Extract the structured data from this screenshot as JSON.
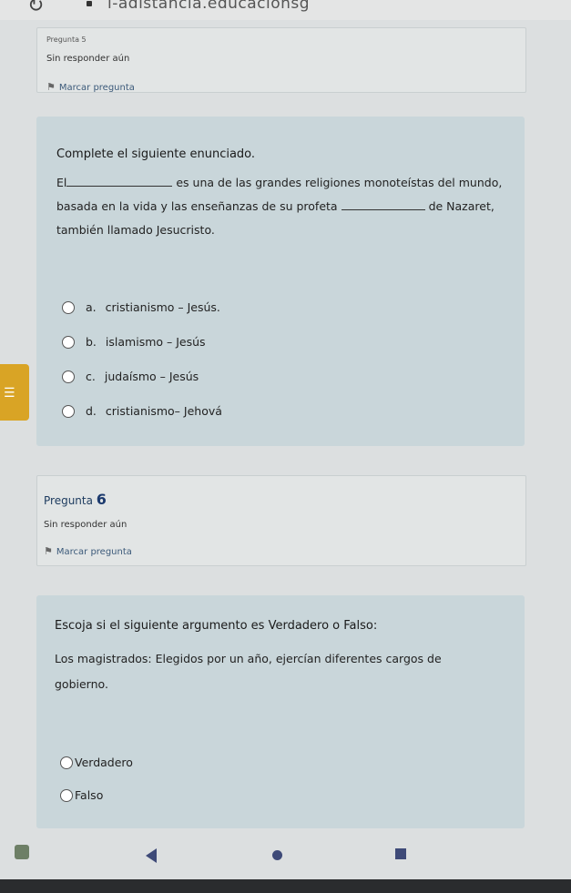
{
  "browser": {
    "url": "i-adistancia.educacionsg"
  },
  "question5_info": {
    "title": "Pregunta 5",
    "status": "Sin responder aún",
    "flag_label": "Marcar pregunta"
  },
  "question5": {
    "prompt": "Complete el siguiente enunciado.",
    "text_start": "El",
    "text_part1": "es una de las grandes religiones monoteístas del mundo,",
    "text_part2": "basada en la vida y las enseñanzas de su profeta",
    "text_part3": "de Nazaret,",
    "text_part4": "también llamado Jesucristo.",
    "options": [
      {
        "letter": "a.",
        "label": "cristianismo – Jesús."
      },
      {
        "letter": "b.",
        "label": "islamismo – Jesús"
      },
      {
        "letter": "c.",
        "label": "judaísmo – Jesús"
      },
      {
        "letter": "d.",
        "label": "cristianismo– Jehová"
      }
    ]
  },
  "question6_info": {
    "title_prefix": "Pregunta",
    "number": "6",
    "status": "Sin responder aún",
    "flag_label": "Marcar pregunta"
  },
  "question6": {
    "prompt": "Escoja si el siguiente argumento es Verdadero o Falso:",
    "statement_line1": "Los magistrados: Elegidos por un año, ejercían diferentes cargos de",
    "statement_line2": "gobierno.",
    "options": [
      {
        "label": "Verdadero"
      },
      {
        "label": "Falso"
      }
    ]
  },
  "icons": {
    "reload": "reload-icon",
    "lock": "lock-icon",
    "flag": "flag-icon",
    "menu": "menu-icon",
    "back": "back-triangle-icon",
    "home": "home-circle-icon",
    "recent": "recent-square-icon"
  },
  "colors": {
    "accent_tab": "#d9a425",
    "question_bg": "#c9d6da",
    "nav_icon": "#3e4a78"
  }
}
